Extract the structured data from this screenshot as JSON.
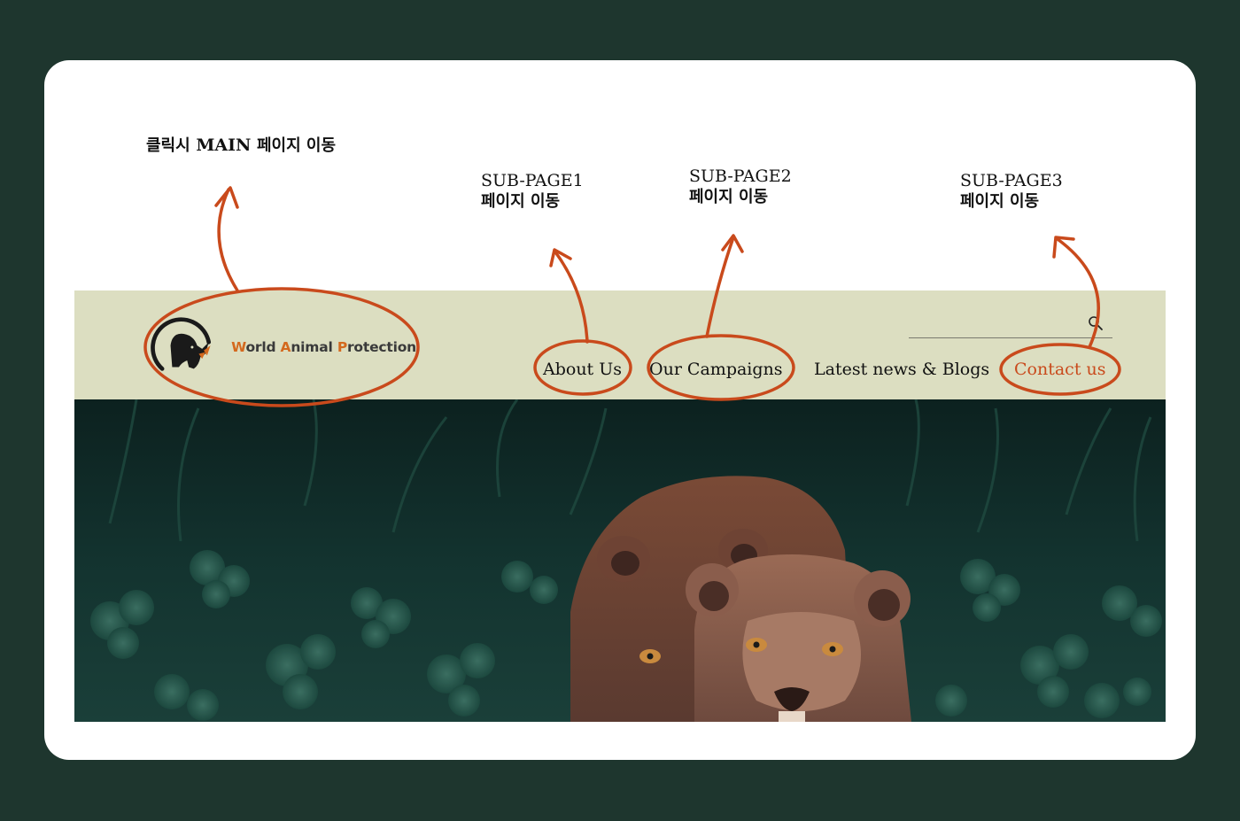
{
  "annotations": {
    "main": {
      "ko_prefix": "클릭시",
      "en": "MAIN",
      "ko_suffix": "페이지 이동"
    },
    "sub1": {
      "en": "SUB-PAGE1",
      "ko": "페이지 이동"
    },
    "sub2": {
      "en": "SUB-PAGE2",
      "ko": "페이지 이동"
    },
    "sub3": {
      "en": "SUB-PAGE3",
      "ko": "페이지 이동"
    }
  },
  "header": {
    "logo": {
      "w": "W",
      "orld": "orld ",
      "a": "A",
      "nimal": "nimal ",
      "p": "P",
      "rotection": "rotection",
      "icon": "rhino-logo-icon"
    },
    "search": {
      "value": "",
      "icon": "search-icon"
    },
    "nav": [
      {
        "label": "About Us"
      },
      {
        "label": "Our Campaigns"
      },
      {
        "label": "Latest news & Blogs"
      },
      {
        "label": "Contact us"
      }
    ]
  },
  "hero": {
    "subject": "two lionesses in dark green foliage"
  },
  "colors": {
    "background": "#1e362e",
    "card": "#ffffff",
    "header": "#dcdec1",
    "accent": "#c94a1c",
    "logo_accent": "#d4691e"
  }
}
